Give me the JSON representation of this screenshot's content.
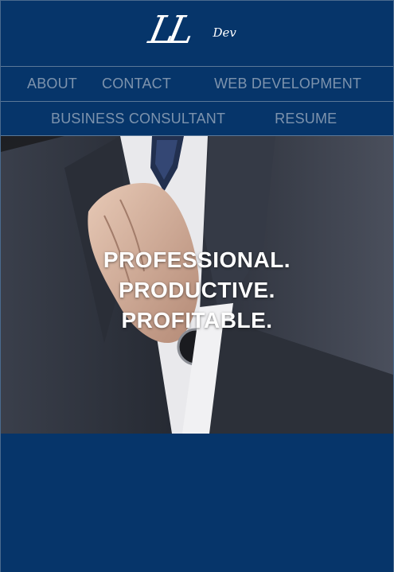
{
  "logo": {
    "initials": "LL",
    "suffix": "Dev"
  },
  "nav": {
    "row1": [
      "ABOUT",
      "CONTACT",
      "WEB DEVELOPMENT"
    ],
    "row2": [
      "BUSINESS CONSULTANT",
      "RESUME"
    ]
  },
  "hero": {
    "lines": [
      "PROFESSIONAL.",
      "PRODUCTIVE.",
      "PROFITABLE."
    ]
  },
  "colors": {
    "background": "#06356a",
    "nav_text": "#7d93ad",
    "hero_text": "#ffffff"
  }
}
